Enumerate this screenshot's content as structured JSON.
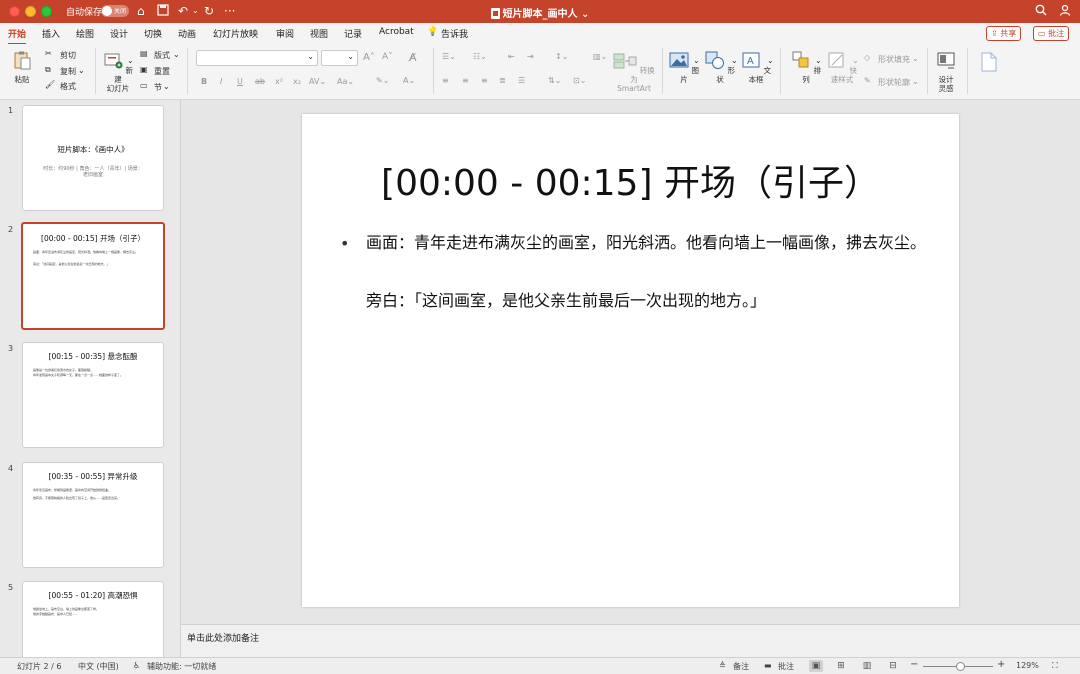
{
  "titlebar": {
    "autosave_label": "自动保存",
    "autosave_state": "关闭",
    "document_title": "短片脚本_画中人",
    "undo_icon": "undo-icon",
    "redo_icon": "redo-icon"
  },
  "tabs": [
    {
      "label": "开始",
      "active": true
    },
    {
      "label": "插入"
    },
    {
      "label": "绘图"
    },
    {
      "label": "设计"
    },
    {
      "label": "切换"
    },
    {
      "label": "动画"
    },
    {
      "label": "幻灯片放映"
    },
    {
      "label": "审阅"
    },
    {
      "label": "视图"
    },
    {
      "label": "记录"
    },
    {
      "label": "Acrobat"
    },
    {
      "label": "告诉我"
    }
  ],
  "share": {
    "share_label": "共享",
    "comment_label": "批注"
  },
  "ribbon": {
    "paste": "粘贴",
    "cut": "剪切",
    "copy": "复制",
    "format": "格式",
    "new_slide_line1": "新建",
    "new_slide_line2": "幻灯片",
    "layout": "版式",
    "reset": "重置",
    "section": "节",
    "convert_line1": "转换为",
    "convert_line2": "SmartArt",
    "picture": "图片",
    "shape": "形状",
    "textbox": "文本框",
    "arrange": "排列",
    "quick_styles": "快速样式",
    "shape_fill": "形状填充",
    "shape_outline": "形状轮廓",
    "designer_line1": "设计",
    "designer_line2": "灵感"
  },
  "slides": [
    {
      "number": "1",
      "title": "短片脚本：《画中人》",
      "subtitle": "时长：约90秒 | 角色：一人（青年）| 场景：老旧画室"
    },
    {
      "number": "2",
      "title": "[00:00 - 00:15] 开场（引子）",
      "lines": [
        "画面：青年走进布满灰尘的画室，阳光斜洒。他看向墙上一幅画像，拂去灰尘。",
        "旁白：「这间画室，是他父亲生前最后一次出现的地方。」"
      ],
      "selected": true
    },
    {
      "number": "3",
      "title": "[00:15 - 00:35] 悬念酝酿",
      "lines": [
        "画像是一位穿着红色围巾的女子，面容模糊。",
        "青年发现画中女子轮廓每一天，都在一点一点……她面的样子变了。"
      ]
    },
    {
      "number": "4",
      "title": "[00:35 - 00:55] 异常升级",
      "lines": [
        "青年靠近画布，却看到画像里，画中的空间开始微微扭曲。",
        "他转身，不断照映着的人脸出现了镜子上，他从……画里走出来。"
      ]
    },
    {
      "number": "5",
      "title": "[00:55 - 01:20] 高潮恐惧",
      "lines": [
        "他跌坐地上，画布空白，墙上的画像全都变了样。",
        "他的手触碰画布，画中人已经……"
      ]
    }
  ],
  "current_slide": {
    "title": "[00:00 - 00:15] 开场（引子）",
    "bullet": "•",
    "body1": "画面：青年走进布满灰尘的画室，阳光斜洒。他看向墙上一幅画像，拂去灰尘。",
    "body2": "旁白：「这间画室，是他父亲生前最后一次出现的地方。」"
  },
  "notes_placeholder": "单击此处添加备注",
  "status": {
    "slide_counter": "幻灯片 2 / 6",
    "language": "中文 (中国)",
    "accessibility": "辅助功能: 一切就绪",
    "notes": "备注",
    "comments": "批注",
    "zoom_level": "129%"
  }
}
